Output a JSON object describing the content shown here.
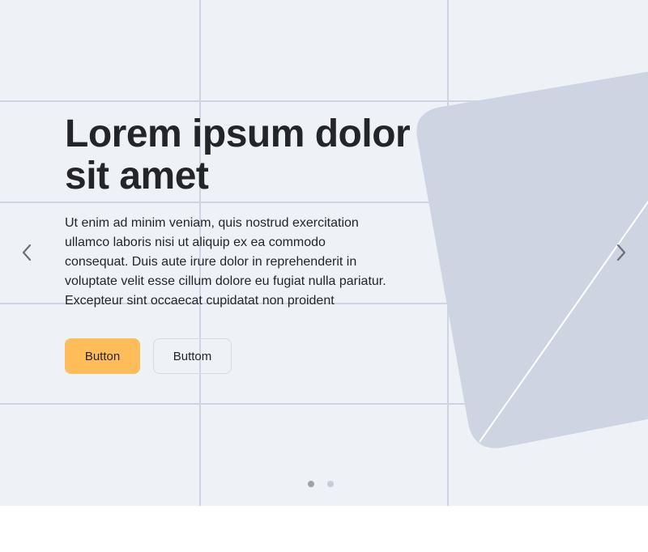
{
  "hero": {
    "title": "Lorem ipsum dolor sit amet",
    "body": "Ut enim ad minim veniam, quis nostrud exercitation ullamco laboris nisi ut aliquip ex ea commodo consequat. Duis aute irure dolor in reprehenderit in voluptate velit esse cillum dolore eu fugiat nulla pariatur. Excepteur sint occaecat cupidatat non proident",
    "primary_button": "Button",
    "secondary_button": "Buttom"
  },
  "carousel": {
    "prev_icon": "chevron-left-icon",
    "next_icon": "chevron-right-icon",
    "slide_count": 2,
    "active_slide": 1
  },
  "colors": {
    "background": "#eef1f6",
    "grid": "#cfd4e2",
    "shape": "#cfd4e2",
    "primary_button": "#ffbd59",
    "text": "#242528"
  }
}
